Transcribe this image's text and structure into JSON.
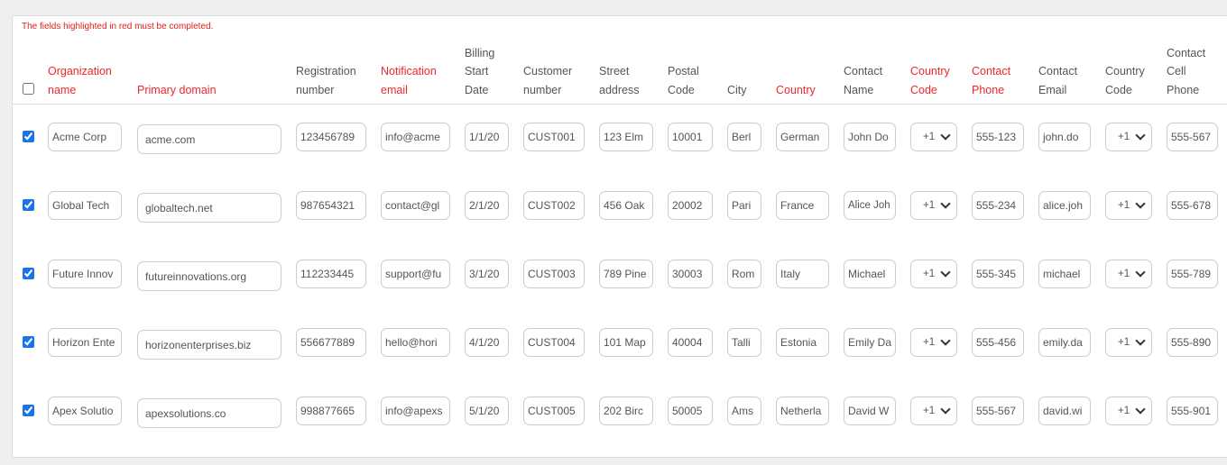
{
  "notice": "The fields highlighted in red must be completed.",
  "colors": {
    "required": "#f0262b",
    "checkbox": "#1a73e8"
  },
  "columns": [
    {
      "key": "org",
      "label": [
        "Organization",
        "name"
      ],
      "required": true
    },
    {
      "key": "domain",
      "label": [
        "Primary domain"
      ],
      "required": true
    },
    {
      "key": "reg",
      "label": [
        "Registration",
        "number"
      ],
      "required": false
    },
    {
      "key": "notif",
      "label": [
        "Notification",
        "email"
      ],
      "required": true
    },
    {
      "key": "billing",
      "label": [
        "Billing",
        "Start",
        "Date"
      ],
      "required": false
    },
    {
      "key": "cust",
      "label": [
        "Customer",
        "number"
      ],
      "required": false
    },
    {
      "key": "street",
      "label": [
        "Street",
        "address"
      ],
      "required": false
    },
    {
      "key": "postal",
      "label": [
        "Postal",
        "Code"
      ],
      "required": false
    },
    {
      "key": "city",
      "label": [
        "City"
      ],
      "required": false
    },
    {
      "key": "country",
      "label": [
        "Country"
      ],
      "required": true
    },
    {
      "key": "cname",
      "label": [
        "Contact",
        "Name"
      ],
      "required": false
    },
    {
      "key": "cc",
      "label": [
        "Country",
        "Code"
      ],
      "required": true,
      "select": true
    },
    {
      "key": "phone",
      "label": [
        "Contact",
        "Phone"
      ],
      "required": true
    },
    {
      "key": "email",
      "label": [
        "Contact",
        "Email"
      ],
      "required": false
    },
    {
      "key": "cc2",
      "label": [
        "Country",
        "Code"
      ],
      "required": false,
      "select": true
    },
    {
      "key": "cell",
      "label": [
        "Contact",
        "Cell",
        "Phone"
      ],
      "required": false
    }
  ],
  "select_all_checked": false,
  "rows": [
    {
      "checked": true,
      "org": "Acme Corp",
      "domain": "acme.com",
      "reg": "123456789",
      "notif": "info@acme",
      "billing": "1/1/20",
      "cust": "CUST001",
      "street": "123 Elm",
      "postal": "10001",
      "city": "Berl",
      "country": "German",
      "cname": "John Do",
      "cc": "+1",
      "phone": "555-123",
      "email": "john.do",
      "cc2": "+1",
      "cell": "555-567"
    },
    {
      "checked": true,
      "org": "Global Tech",
      "domain": "globaltech.net",
      "reg": "987654321",
      "notif": "contact@gl",
      "billing": "2/1/20",
      "cust": "CUST002",
      "street": "456 Oak",
      "postal": "20002",
      "city": "Pari",
      "country": "France",
      "cname": "Alice Joh",
      "cc": "+1",
      "phone": "555-234",
      "email": "alice.joh",
      "cc2": "+1",
      "cell": "555-678"
    },
    {
      "checked": true,
      "org": "Future Innov",
      "domain": "futureinnovations.org",
      "reg": "112233445",
      "notif": "support@fu",
      "billing": "3/1/20",
      "cust": "CUST003",
      "street": "789 Pine",
      "postal": "30003",
      "city": "Rom",
      "country": "Italy",
      "cname": "Michael",
      "cc": "+1",
      "phone": "555-345",
      "email": "michael",
      "cc2": "+1",
      "cell": "555-789"
    },
    {
      "checked": true,
      "org": "Horizon Ente",
      "domain": "horizonenterprises.biz",
      "reg": "556677889",
      "notif": "hello@hori",
      "billing": "4/1/20",
      "cust": "CUST004",
      "street": "101 Map",
      "postal": "40004",
      "city": "Talli",
      "country": "Estonia",
      "cname": "Emily Da",
      "cc": "+1",
      "phone": "555-456",
      "email": "emily.da",
      "cc2": "+1",
      "cell": "555-890"
    },
    {
      "checked": true,
      "org": "Apex Solutio",
      "domain": "apexsolutions.co",
      "reg": "998877665",
      "notif": "info@apexs",
      "billing": "5/1/20",
      "cust": "CUST005",
      "street": "202 Birc",
      "postal": "50005",
      "city": "Ams",
      "country": "Netherla",
      "cname": "David W",
      "cc": "+1",
      "phone": "555-567",
      "email": "david.wi",
      "cc2": "+1",
      "cell": "555-901"
    }
  ]
}
